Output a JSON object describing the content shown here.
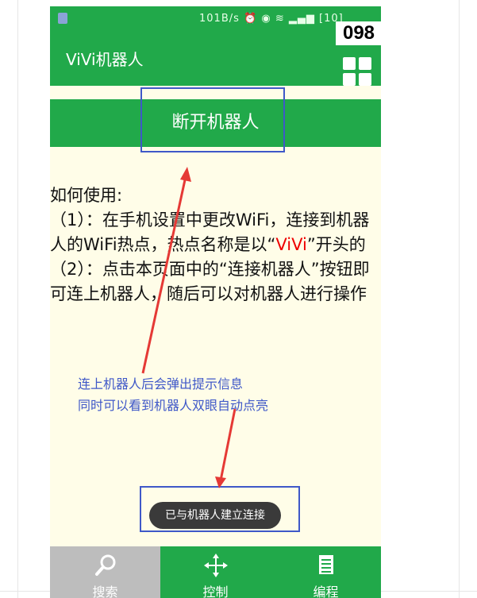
{
  "status_bar": {
    "network_speed": "101B/s",
    "icons": [
      "sim-icon",
      "alarm-icon",
      "eye-icon",
      "wifi-icon",
      "signal-icon",
      "battery-icon"
    ],
    "battery": "10"
  },
  "app_bar": {
    "title": "ViVi机器人",
    "menu_icon": "grid-menu-icon"
  },
  "badge": "098",
  "connect_button": {
    "label": "断开机器人"
  },
  "instructions": {
    "heading": "如何使用:",
    "step1_a": "（1）：在手机设置中更改WiFi，连接到机器人的WiFi热点，热点名称是以“",
    "step1_highlight": "ViVi",
    "step1_b": "”开头的",
    "step2": "（2）：点击本页面中的“连接机器人”按钮即可连上机器人，随后可以对机器人进行操作"
  },
  "annotation": {
    "line1": "连上机器人后会弹出提示信息",
    "line2": "同时可以看到机器人双眼自动点亮"
  },
  "toast": "已与机器人建立连接",
  "bottom_nav": [
    {
      "label": "搜索",
      "icon": "search-icon",
      "active": false
    },
    {
      "label": "控制",
      "icon": "move-arrows-icon",
      "active": true
    },
    {
      "label": "编程",
      "icon": "list-icon",
      "active": true
    }
  ],
  "colors": {
    "primary_green": "#21a94a",
    "background": "#fffde8",
    "annotation_blue": "#3f58c8",
    "annotation_red": "#e53935",
    "highlight_red": "#ee0000"
  }
}
